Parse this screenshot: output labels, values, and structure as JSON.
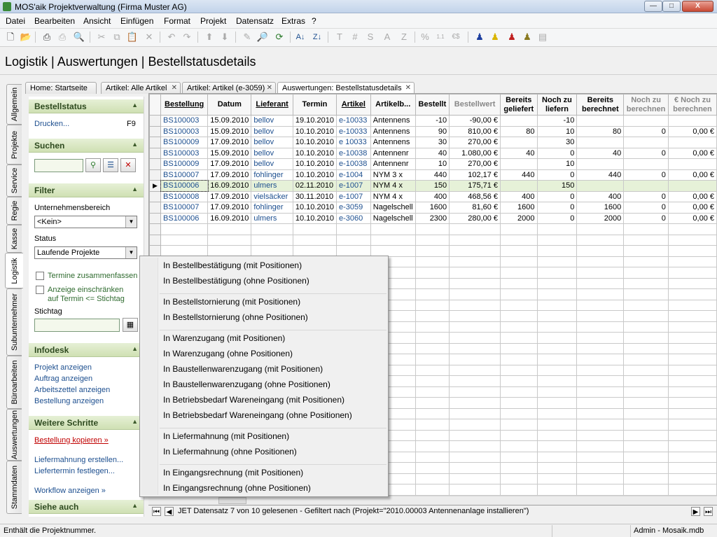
{
  "window": {
    "title": "MOS'aik Projektverwaltung (Firma Muster AG)",
    "min": "—",
    "max": "□",
    "close": "X"
  },
  "menu": [
    "Datei",
    "Bearbeiten",
    "Ansicht",
    "Einfügen",
    "Format",
    "Projekt",
    "Datensatz",
    "Extras",
    "?"
  ],
  "toolbar_text": {
    "t": "T",
    "hash": "#",
    "s": "S",
    "a": "A",
    "z": "Z",
    "percent": "%",
    "frac": "1.1",
    "euro": "€$"
  },
  "page_title": "Logistik | Auswertungen | Bestellstatusdetails",
  "vtabs": [
    "Allgemein",
    "Projekte",
    "Service",
    "Regie",
    "Kasse",
    "Logistik",
    "Subunternehmer",
    "Büroarbeiten",
    "Auswertungen",
    "Stammdaten"
  ],
  "doc_tabs": [
    "Home: Startseite",
    "Artikel: Alle Artikel",
    "Artikel: Artikel (e-3059)",
    "Auswertungen: Bestellstatusdetails"
  ],
  "sidebar": {
    "bestellstatus": {
      "title": "Bestellstatus",
      "print": "Drucken...",
      "print_key": "F9"
    },
    "suchen": {
      "title": "Suchen"
    },
    "filter": {
      "title": "Filter",
      "bereich_label": "Unternehmensbereich",
      "bereich_value": "<Kein>",
      "status_label": "Status",
      "status_value": "Laufende Projekte",
      "termine": "Termine zusammenfassen",
      "anzeige1": "Anzeige einschränken",
      "anzeige2": "auf Termin <= Stichtag",
      "stichtag": "Stichtag"
    },
    "infodesk": {
      "title": "Infodesk",
      "links": [
        "Projekt anzeigen",
        "Auftrag anzeigen",
        "Arbeitszettel anzeigen",
        "Bestellung anzeigen"
      ]
    },
    "weitere": {
      "title": "Weitere Schritte",
      "copy": "Bestellung kopieren »",
      "mahn": "Liefermahnung erstellen...",
      "termin": "Liefertermin festlegen...",
      "workflow": "Workflow anzeigen »"
    },
    "siehe": {
      "title": "Siehe auch"
    }
  },
  "grid": {
    "headers": [
      {
        "l1": "Bestellung",
        "l2": "",
        "u": true
      },
      {
        "l1": "Datum",
        "l2": ""
      },
      {
        "l1": "Lieferant",
        "l2": "",
        "u": true
      },
      {
        "l1": "Termin",
        "l2": ""
      },
      {
        "l1": "Artikel",
        "l2": "",
        "u": true
      },
      {
        "l1": "Artikelb...",
        "l2": ""
      },
      {
        "l1": "Bestellt",
        "l2": ""
      },
      {
        "l1": "Bestellwert",
        "l2": "",
        "grey": true
      },
      {
        "l1": "Bereits",
        "l2": "geliefert"
      },
      {
        "l1": "Noch zu",
        "l2": "liefern"
      },
      {
        "l1": "Bereits",
        "l2": "berechnet"
      },
      {
        "l1": "Noch zu",
        "l2": "berechnen",
        "grey": true
      },
      {
        "l1": "€ Noch zu",
        "l2": "berechnen",
        "grey": true
      }
    ],
    "rows": [
      [
        "BS100003",
        "15.09.2010",
        "bellov",
        "19.10.2010",
        "e-10033",
        "Antennens",
        "-10",
        "-90,00 €",
        "",
        "-10",
        "",
        "",
        ""
      ],
      [
        "BS100003",
        "15.09.2010",
        "bellov",
        "10.10.2010",
        "e-10033",
        "Antennens",
        "90",
        "810,00 €",
        "80",
        "10",
        "80",
        "0",
        "0,00 €"
      ],
      [
        "BS100009",
        "17.09.2010",
        "bellov",
        "10.10.2010",
        "e 10033",
        "Antennens",
        "30",
        "270,00 €",
        "",
        "30",
        "",
        "",
        ""
      ],
      [
        "BS100003",
        "15.09.2010",
        "bellov",
        "10.10.2010",
        "e-10038",
        "Antennenr",
        "40",
        "1.080,00 €",
        "40",
        "0",
        "40",
        "0",
        "0,00 €"
      ],
      [
        "BS100009",
        "17.09.2010",
        "bellov",
        "10.10.2010",
        "e-10038",
        "Antennenr",
        "10",
        "270,00 €",
        "",
        "10",
        "",
        "",
        ""
      ],
      [
        "BS100007",
        "17.09.2010",
        "fohlinger",
        "10.10.2010",
        "e-1004",
        "NYM 3 x",
        "440",
        "102,17 €",
        "440",
        "0",
        "440",
        "0",
        "0,00 €"
      ],
      [
        "BS100006",
        "16.09.2010",
        "ulmers",
        "02.11.2010",
        "e-1007",
        "NYM 4 x",
        "150",
        "175,71 €",
        "",
        "150",
        "",
        "",
        ""
      ],
      [
        "BS100008",
        "17.09.2010",
        "vielsäcker",
        "30.11.2010",
        "e-1007",
        "NYM 4 x",
        "400",
        "468,56 €",
        "400",
        "0",
        "400",
        "0",
        "0,00 €"
      ],
      [
        "BS100007",
        "17.09.2010",
        "fohlinger",
        "10.10.2010",
        "e-3059",
        "Nagelschell",
        "1600",
        "81,60 €",
        "1600",
        "0",
        "1600",
        "0",
        "0,00 €"
      ],
      [
        "BS100006",
        "16.09.2010",
        "ulmers",
        "10.10.2010",
        "e-3060",
        "Nagelschell",
        "2300",
        "280,00 €",
        "2000",
        "0",
        "2000",
        "0",
        "0,00 €"
      ]
    ],
    "selected_row": 6
  },
  "nav": {
    "status": "JET Datensatz 7 von 10 gelesenen - Gefiltert nach (Projekt=\"2010.00003 Antennenanlage installieren\")"
  },
  "statusbar": {
    "left": "Enthält die Projektnummer.",
    "right": "Admin - Mosaik.mdb"
  },
  "context_menu": [
    [
      "In Bestellbestätigung (mit Positionen)",
      "In Bestellbestätigung (ohne Positionen)"
    ],
    [
      "In Bestellstornierung (mit Positionen)",
      "In Bestellstornierung (ohne Positionen)"
    ],
    [
      "In Warenzugang (mit Positionen)",
      "In Warenzugang (ohne Positionen)",
      "In Baustellenwarenzugang (mit Positionen)",
      "In Baustellenwarenzugang (ohne Positionen)",
      "In Betriebsbedarf Wareneingang (mit Positionen)",
      "In Betriebsbedarf Wareneingang (ohne Positionen)"
    ],
    [
      "In Liefermahnung (mit Positionen)",
      "In Liefermahnung (ohne Positionen)"
    ],
    [
      "In Eingangsrechnung (mit Positionen)",
      "In Eingangsrechnung (ohne Positionen)"
    ]
  ]
}
